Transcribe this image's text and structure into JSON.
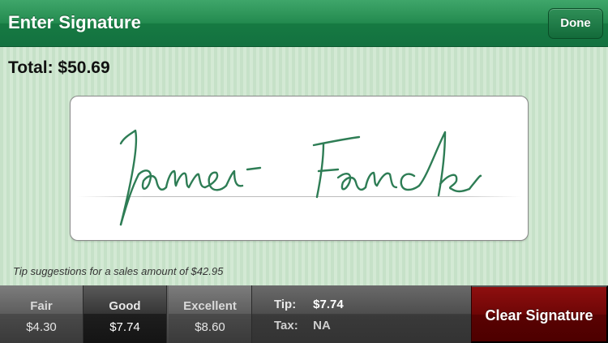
{
  "header": {
    "title": "Enter Signature",
    "done_label": "Done"
  },
  "total": {
    "text": "Total: $50.69"
  },
  "signature": {
    "has_signature": true,
    "ink_color": "#2e7d55"
  },
  "tip_note": "Tip suggestions for a sales amount of $42.95",
  "tip_options": [
    {
      "label": "Fair",
      "amount": "$4.30",
      "selected": false
    },
    {
      "label": "Good",
      "amount": "$7.74",
      "selected": true
    },
    {
      "label": "Excellent",
      "amount": "$8.60",
      "selected": false
    }
  ],
  "summary": {
    "tip_label": "Tip:",
    "tip_value": "$7.74",
    "tax_label": "Tax:",
    "tax_value": "NA"
  },
  "clear_label": "Clear Signature",
  "colors": {
    "header_green": "#238a4f",
    "clear_red": "#6f0606",
    "background_stripe": "#c9e3cb"
  },
  "icons": {
    "signature_ink": "handwritten-signature"
  }
}
